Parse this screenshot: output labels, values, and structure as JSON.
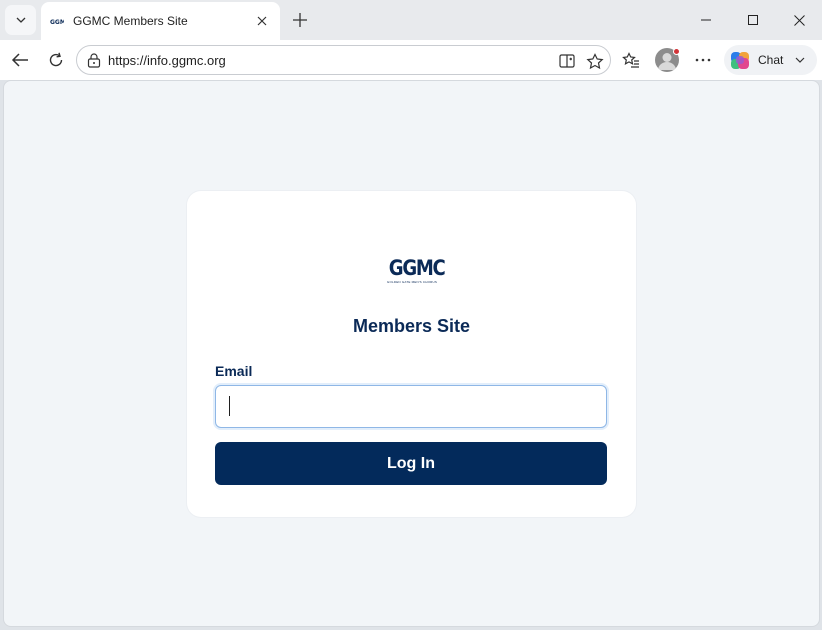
{
  "browser": {
    "tab": {
      "title": "GGMC Members Site",
      "favicon": "ggmc-favicon"
    },
    "address_bar": {
      "url": "https://info.ggmc.org"
    },
    "chat_button": {
      "label": "Chat"
    },
    "icons": {
      "tab_menu": "chevron-down-icon",
      "close_tab": "close-icon",
      "new_tab": "plus-icon",
      "minimize": "minimize-icon",
      "maximize": "maximize-icon",
      "close_window": "close-icon",
      "back": "back-arrow-icon",
      "refresh": "refresh-icon",
      "lock": "lock-icon",
      "split_screen": "split-screen-icon",
      "favorite": "star-icon",
      "favorites_list": "favorites-list-icon",
      "profile": "profile-avatar",
      "more": "more-icon",
      "copilot": "copilot-icon"
    }
  },
  "login_card": {
    "logo_text": "GGMC",
    "logo_subtext": "GOLDEN GATE MEN'S CHORUS",
    "title": "Members Site",
    "email_label": "Email",
    "email_value": "",
    "login_button": "Log In"
  },
  "colors": {
    "brand_navy": "#032a5b",
    "heading_navy": "#0b2a57",
    "page_background": "#f2f5f8",
    "input_focus_border": "#8fb7e6"
  }
}
